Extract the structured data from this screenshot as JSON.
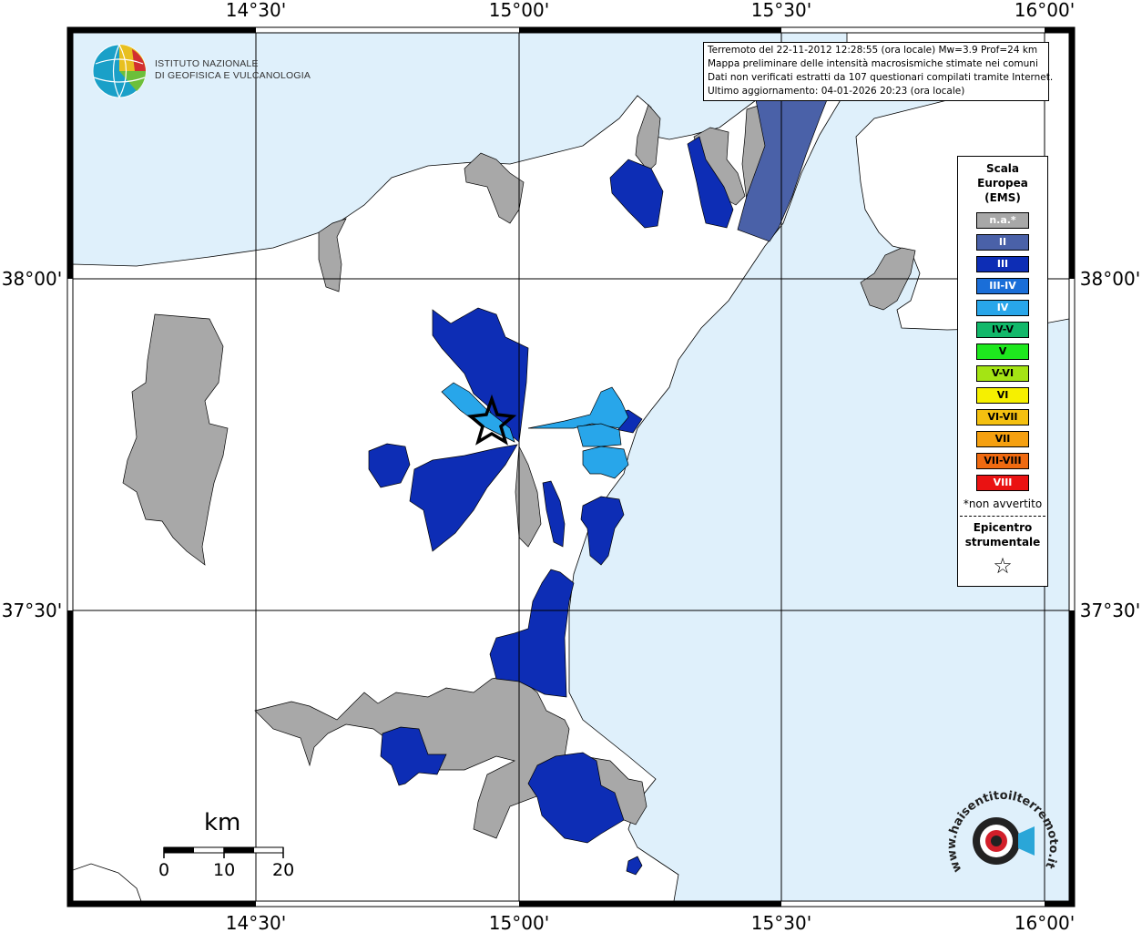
{
  "info": {
    "line1": "Terremoto del 22-11-2012 12:28:55 (ora locale) Mw=3.9 Prof=24 km",
    "line2": "Mappa preliminare delle intensità macrosismiche stimate nei comuni",
    "line3": "Dati non verificati estratti da 107 questionari compilati tramite Internet.",
    "line4": "Ultimo aggiornamento: 04-01-2026 20:23 (ora locale)"
  },
  "ingv": {
    "line1": "ISTITUTO NAZIONALE",
    "line2": "DI GEOFISICA E VULCANOLOGIA"
  },
  "axes": {
    "lon_labels": [
      "14°30'",
      "15°00'",
      "15°30'",
      "16°00'"
    ],
    "lat_labels": [
      "38°00'",
      "37°30'"
    ]
  },
  "legend": {
    "title": [
      "Scala",
      "Europea",
      "(EMS)"
    ],
    "items": [
      {
        "label": "n.a.*",
        "color": "#a8a8a8"
      },
      {
        "label": "II",
        "color": "#4a61a8"
      },
      {
        "label": "III",
        "color": "#0d2db5"
      },
      {
        "label": "III-IV",
        "color": "#1a6ed8"
      },
      {
        "label": "IV",
        "color": "#28a6ea"
      },
      {
        "label": "IV-V",
        "color": "#12b86a"
      },
      {
        "label": "V",
        "color": "#1ee81e"
      },
      {
        "label": "V-VI",
        "color": "#a4e414"
      },
      {
        "label": "VI",
        "color": "#f6f000"
      },
      {
        "label": "VI-VII",
        "color": "#f4c010"
      },
      {
        "label": "VII",
        "color": "#f5a010"
      },
      {
        "label": "VII-VIII",
        "color": "#f06a10"
      },
      {
        "label": "VIII",
        "color": "#ea1212"
      }
    ],
    "note": "*non avvertito",
    "epicenter_title": [
      "Epicentro",
      "strumentale"
    ],
    "epicenter_symbol": "☆"
  },
  "scale_bar": {
    "unit": "km",
    "labels": [
      "0",
      "10",
      "20"
    ]
  },
  "colors": {
    "sea": "#dff0fb",
    "land": "#ffffff",
    "na": "#a8a8a8",
    "ii": "#4a61a8",
    "iii": "#0d2db5",
    "iii_iv": "#1a6ed8",
    "iv": "#28a6ea"
  },
  "watermark": {
    "text": "www.haisentitoilterremoto.it"
  }
}
